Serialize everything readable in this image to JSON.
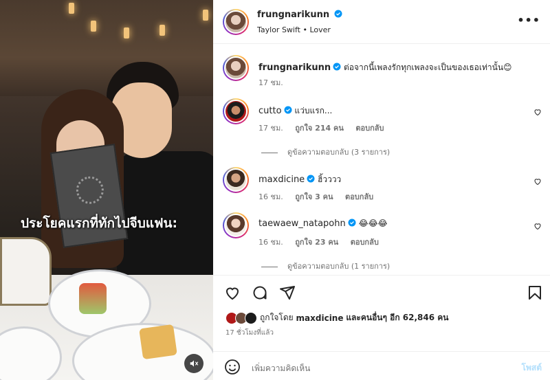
{
  "media": {
    "caption": "ประโยคแรกที่ทักไปจีบแฟน:"
  },
  "header": {
    "username": "frungnarikunn",
    "audio": "Taylor Swift • Lover",
    "more_label": "•••"
  },
  "caption_post": {
    "username": "frungnarikunn",
    "text": "ต่อจากนี้เพลงรักทุกเพลงจะเป็นของเธอเท่านั้น😊",
    "time": "17 ชม."
  },
  "comments": [
    {
      "username": "cutto",
      "text": "แว่บแรก...",
      "time": "17 ชม.",
      "likes": "ถูกใจ 214 คน",
      "reply": "ตอบกลับ",
      "view_replies": "ดูข้อความตอบกลับ (3 รายการ)"
    },
    {
      "username": "maxdicine",
      "text": "ฮิ้วววว",
      "time": "16 ชม.",
      "likes": "ถูกใจ 3 คน",
      "reply": "ตอบกลับ"
    },
    {
      "username": "taewaew_natapohn",
      "text": "😂😂😂",
      "time": "16 ชม.",
      "likes": "ถูกใจ 23 คน",
      "reply": "ตอบกลับ",
      "view_replies": "ดูข้อความตอบกลับ (1 รายการ)"
    }
  ],
  "footer": {
    "liked_by_prefix": "ถูกใจโดย ",
    "liked_by_user": "maxdicine",
    "liked_by_suffix": " และคนอื่นๆ อีก 62,846 คน",
    "time_ago": "17 ชั่วโมงที่แล้ว",
    "add_comment_placeholder": "เพิ่มความคิดเห็น",
    "post_label": "โพสต์"
  },
  "icons": [
    "heart-icon",
    "comment-icon",
    "share-icon",
    "save-icon",
    "emoji-icon",
    "mute-icon",
    "verified-icon",
    "more-icon"
  ],
  "colors": {
    "verified": "#0095f6",
    "muted_text": "#737373",
    "post_disabled": "#b2dffc"
  }
}
